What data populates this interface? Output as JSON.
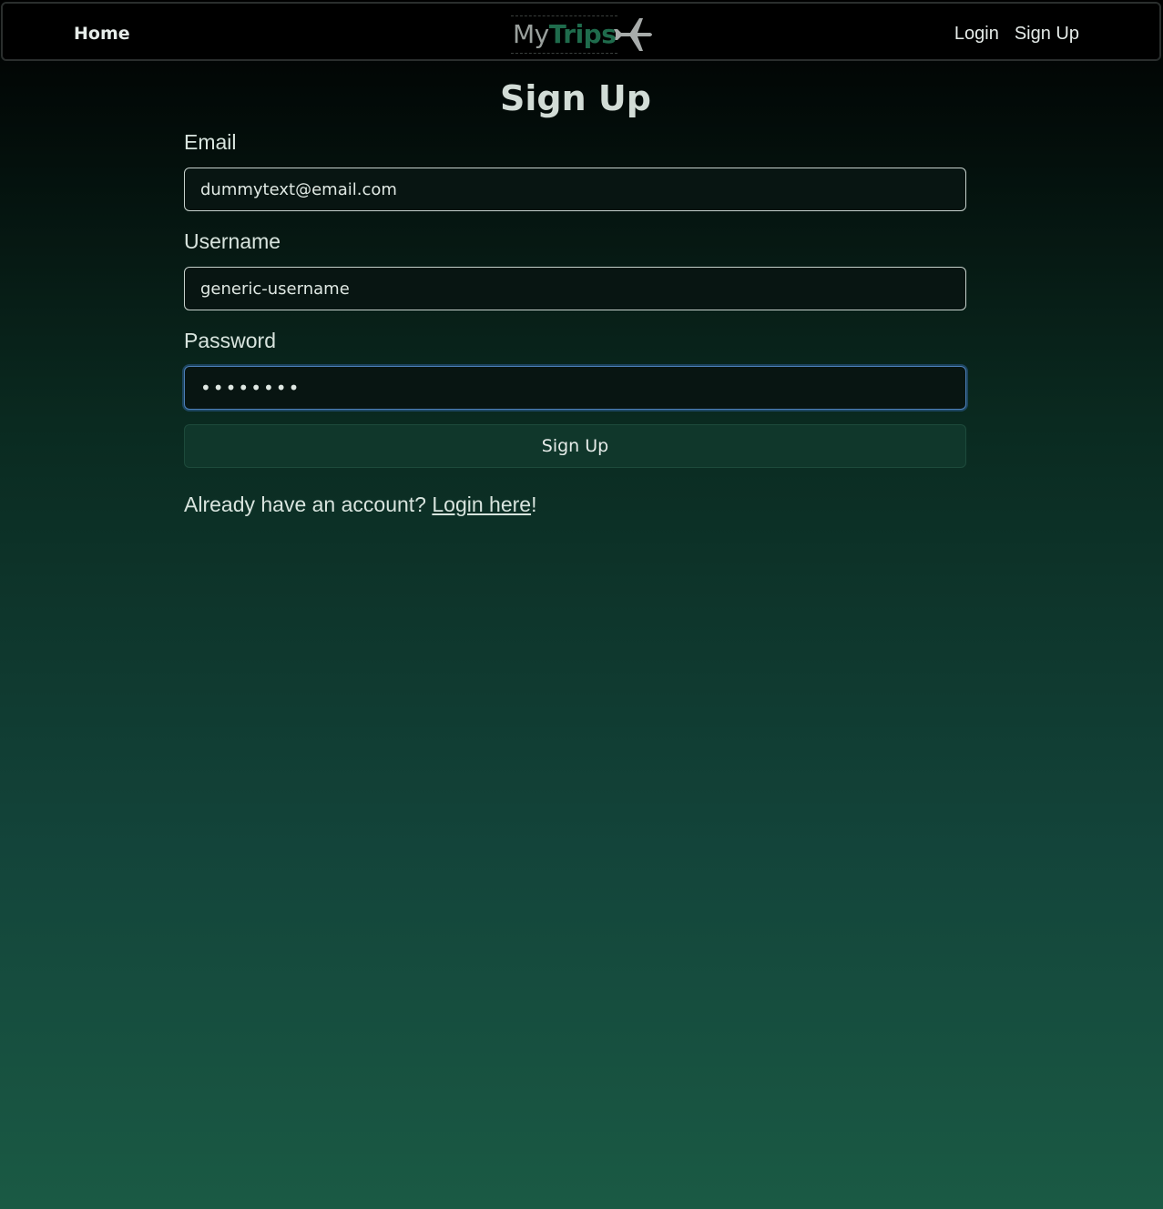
{
  "nav": {
    "home_label": "Home",
    "logo_my": "My",
    "logo_trips": "Trips",
    "login_label": "Login",
    "signup_label": "Sign Up"
  },
  "page": {
    "title": "Sign Up"
  },
  "form": {
    "email_label": "Email",
    "email_value": "dummytext@email.com",
    "username_label": "Username",
    "username_value": "generic-username",
    "password_label": "Password",
    "password_value": "••••••••",
    "submit_label": "Sign Up"
  },
  "footer": {
    "prefix": "Already have an account? ",
    "link_label": "Login here",
    "suffix": "!"
  },
  "colors": {
    "brand_green": "#1f6b4c",
    "button_bg": "#10372b",
    "focus_ring": "#4d7fb8"
  },
  "icons": {
    "logo_icon": "airplane-icon"
  }
}
